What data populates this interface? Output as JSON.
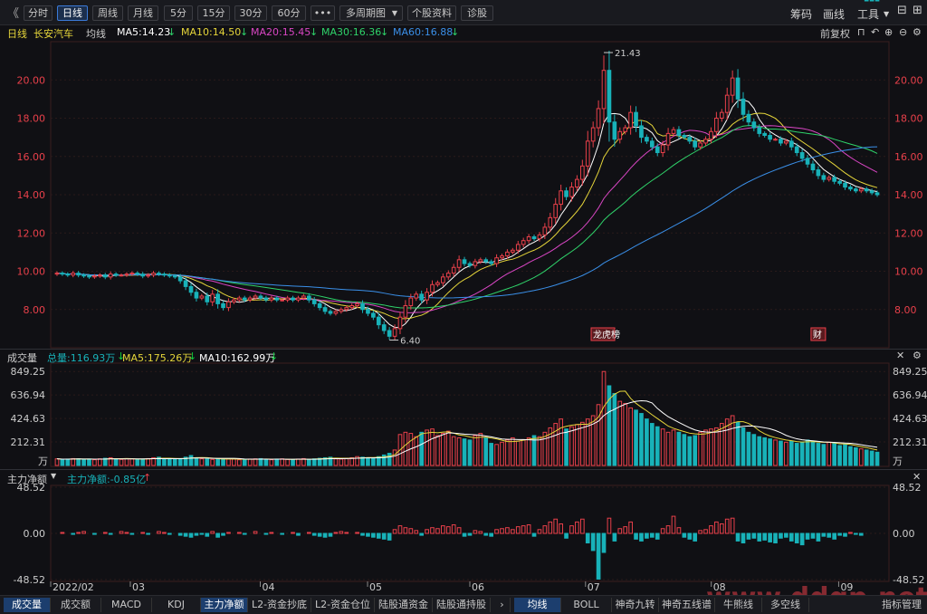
{
  "toolbar": {
    "back": "《",
    "periods": [
      "分时",
      "日线",
      "周线",
      "月线",
      "5分",
      "15分",
      "30分",
      "60分",
      "•••",
      "多周期图",
      "个股资料",
      "诊股"
    ],
    "active_period": "日线",
    "right": [
      "筹码",
      "画线",
      "工具"
    ]
  },
  "ma_row": {
    "period": "日线",
    "name": "长安汽车",
    "avg": "均线",
    "ma5": "MA5:14.23",
    "ma10": "MA10:14.50",
    "ma20": "MA20:15.45",
    "ma30": "MA30:16.36",
    "ma60": "MA60:16.88",
    "fq": "前复权"
  },
  "colors": {
    "up": "#e8404a",
    "down": "#18b2b9",
    "ma5": "#ffffff",
    "ma10": "#e5d53a",
    "ma20": "#d946c4",
    "ma30": "#2fd36a",
    "ma60": "#3a8fe8",
    "bg": "#101014",
    "grid": "#2a1a1a",
    "axis_red": "#e8404a"
  },
  "price_axis": {
    "ticks": [
      "20.00",
      "18.00",
      "16.00",
      "14.00",
      "12.00",
      "10.00",
      "8.00"
    ],
    "max_label": "21.43",
    "min_label": "6.40"
  },
  "markers": {
    "rank": "龙虎榜",
    "finance": "财"
  },
  "volume_row": {
    "title": "成交量",
    "total": "总量:116.93万",
    "ma5": "MA5:175.26万",
    "ma10": "MA10:162.99万"
  },
  "volume_axis": {
    "ticks": [
      "849.25",
      "636.94",
      "424.63",
      "212.31"
    ],
    "unit": "万"
  },
  "flow_row": {
    "title": "主力净额",
    "value": "主力净额:-0.85亿"
  },
  "flow_axis": {
    "ticks": [
      "48.52",
      "0.00",
      "-48.52"
    ]
  },
  "date_axis": {
    "labels": [
      "2022/02",
      "03",
      "04",
      "05",
      "06",
      "07",
      "08",
      "09"
    ]
  },
  "bottom_tabs_left": [
    "成交量",
    "成交额",
    "MACD",
    "KDJ",
    "主力净额",
    "L2-资金抄底",
    "L2-资金仓位",
    "陆股通资金",
    "陆股通持股"
  ],
  "bottom_tabs_right": [
    "均线",
    "BOLL",
    "神奇九转",
    "神奇五线谱",
    "牛熊线",
    "多空线"
  ],
  "bottom_right": "指标管理",
  "watermark": "www.ddgp.net",
  "chart_data": {
    "type": "candlestick",
    "title": "长安汽车 日线",
    "price_ylim": [
      6.0,
      22.0
    ],
    "volume_ylim": [
      0,
      900
    ],
    "flow_ylim": [
      -48.52,
      48.52
    ],
    "price_extremes": {
      "high": 21.43,
      "low": 6.4
    },
    "close_series": [
      9.9,
      9.85,
      9.8,
      9.9,
      9.8,
      9.75,
      9.7,
      9.75,
      9.8,
      9.7,
      9.85,
      9.8,
      9.8,
      9.85,
      9.9,
      9.85,
      9.75,
      9.8,
      9.9,
      9.85,
      9.8,
      9.75,
      9.7,
      9.5,
      9.2,
      8.9,
      8.6,
      8.7,
      8.4,
      8.8,
      8.3,
      8.1,
      8.4,
      8.5,
      8.6,
      8.5,
      8.6,
      8.7,
      8.6,
      8.5,
      8.6,
      8.5,
      8.5,
      8.6,
      8.5,
      8.6,
      8.7,
      8.5,
      8.3,
      8.1,
      7.9,
      7.8,
      7.9,
      8.0,
      8.1,
      8.2,
      8.3,
      8.0,
      7.8,
      7.6,
      7.2,
      6.9,
      6.6,
      7.0,
      7.6,
      8.2,
      8.6,
      8.8,
      8.5,
      8.9,
      9.3,
      9.4,
      9.7,
      9.9,
      10.2,
      10.6,
      10.4,
      10.3,
      10.5,
      10.6,
      10.5,
      10.4,
      10.7,
      10.8,
      11.0,
      11.1,
      11.4,
      11.6,
      11.8,
      11.7,
      11.9,
      12.3,
      12.8,
      13.5,
      14.2,
      13.9,
      14.4,
      14.8,
      15.5,
      16.8,
      17.5,
      18.5,
      20.5,
      17.8,
      16.9,
      17.3,
      17.5,
      18.3,
      17.6,
      17.0,
      16.8,
      16.5,
      16.2,
      16.6,
      17.2,
      17.4,
      17.1,
      17.0,
      16.8,
      16.5,
      16.7,
      16.9,
      17.3,
      18.0,
      18.3,
      19.2,
      20.1,
      19.0,
      18.2,
      17.8,
      17.5,
      17.2,
      17.1,
      16.9,
      16.9,
      16.7,
      16.8,
      16.5,
      16.2,
      15.9,
      15.6,
      15.3,
      15.0,
      14.8,
      14.9,
      14.7,
      14.6,
      14.4,
      14.3,
      14.2,
      14.3,
      14.2,
      14.1,
      14.0
    ],
    "volume_series": [
      60,
      55,
      58,
      62,
      60,
      55,
      58,
      52,
      60,
      65,
      70,
      58,
      55,
      62,
      60,
      55,
      58,
      62,
      70,
      75,
      60,
      58,
      55,
      62,
      75,
      90,
      70,
      60,
      58,
      55,
      62,
      55,
      60,
      58,
      52,
      55,
      58,
      60,
      62,
      55,
      52,
      58,
      60,
      55,
      50,
      58,
      62,
      55,
      60,
      65,
      70,
      75,
      60,
      58,
      62,
      70,
      80,
      75,
      70,
      62,
      80,
      95,
      110,
      140,
      280,
      300,
      290,
      260,
      300,
      320,
      330,
      270,
      290,
      310,
      260,
      250,
      240,
      230,
      270,
      290,
      250,
      200,
      190,
      210,
      230,
      250,
      220,
      230,
      250,
      270,
      260,
      300,
      340,
      380,
      420,
      330,
      350,
      370,
      390,
      420,
      450,
      550,
      849,
      720,
      650,
      580,
      560,
      520,
      500,
      470,
      420,
      380,
      350,
      330,
      300,
      320,
      300,
      280,
      260,
      270,
      300,
      320,
      330,
      340,
      380,
      420,
      450,
      390,
      340,
      300,
      280,
      260,
      250,
      240,
      230,
      220,
      210,
      220,
      200,
      210,
      230,
      220,
      200,
      190,
      210,
      200,
      180,
      190,
      170,
      160,
      150,
      140,
      130,
      120
    ],
    "flow_series": [
      0,
      1,
      0,
      -1,
      1,
      2,
      0,
      -1,
      0,
      1,
      -1,
      0,
      2,
      1,
      -1,
      0,
      1,
      -1,
      0,
      2,
      1,
      -1,
      0,
      -2,
      -3,
      -4,
      -2,
      -1,
      -3,
      2,
      -4,
      -2,
      1,
      0,
      1,
      -1,
      0,
      2,
      0,
      -1,
      1,
      0,
      -1,
      0,
      1,
      -2,
      0,
      1,
      -2,
      -3,
      -4,
      -3,
      1,
      2,
      1,
      0,
      1,
      -2,
      -3,
      -4,
      -5,
      -6,
      -7,
      4,
      8,
      6,
      5,
      3,
      -2,
      4,
      6,
      5,
      8,
      7,
      9,
      6,
      -3,
      -2,
      3,
      2,
      -2,
      -3,
      4,
      5,
      6,
      4,
      7,
      8,
      9,
      -3,
      4,
      8,
      12,
      15,
      10,
      -5,
      8,
      12,
      15,
      -10,
      -18,
      -48,
      -20,
      16,
      -8,
      5,
      7,
      12,
      -6,
      -8,
      -5,
      -4,
      -6,
      5,
      8,
      18,
      6,
      -4,
      -6,
      -8,
      3,
      4,
      8,
      12,
      10,
      15,
      16,
      -8,
      -10,
      -6,
      -5,
      -8,
      -7,
      -9,
      -10,
      -5,
      -4,
      -8,
      -10,
      -12,
      -6,
      -5,
      -8,
      -3,
      -4,
      -6,
      -2,
      -3,
      1,
      -1,
      -2
    ]
  }
}
